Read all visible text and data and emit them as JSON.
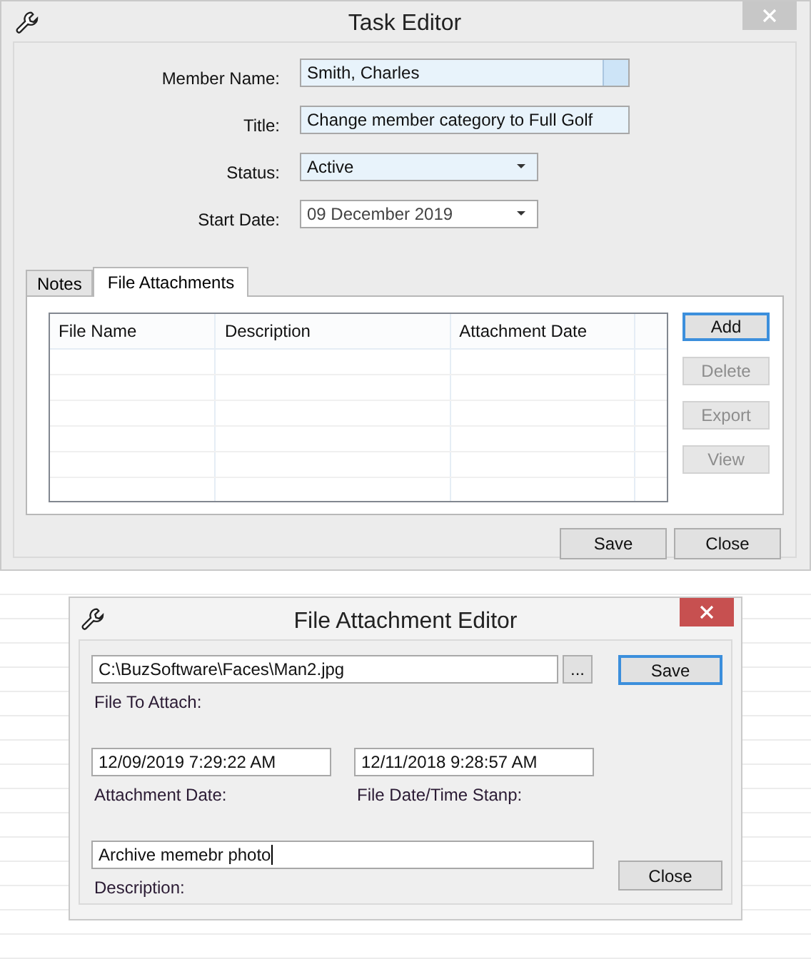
{
  "task_editor": {
    "title": "Task Editor",
    "fields": [
      {
        "kind": "lookup",
        "label": "Member Name:",
        "value": "Smith, Charles"
      },
      {
        "kind": "text",
        "label": "Title:",
        "value": "Change member category to Full Golf"
      },
      {
        "kind": "dropdown",
        "label": "Status:",
        "value": "Active"
      },
      {
        "kind": "date",
        "label": "Start Date:",
        "value": "09 December 2019"
      }
    ],
    "tabs": [
      {
        "label": "Notes",
        "selected": false
      },
      {
        "label": "File Attachments",
        "selected": true
      }
    ],
    "table": {
      "columns": [
        "File Name",
        "Description",
        "Attachment Date"
      ]
    },
    "side_buttons": [
      {
        "label": "Add",
        "disabled": false,
        "focused": true
      },
      {
        "label": "Delete",
        "disabled": true,
        "focused": false
      },
      {
        "label": "Export",
        "disabled": true,
        "focused": false
      },
      {
        "label": "View",
        "disabled": true,
        "focused": false
      }
    ],
    "buttons": [
      "Save",
      "Close"
    ]
  },
  "file_attachment_editor": {
    "title": "File Attachment Editor",
    "file_to_attach": {
      "value": "C:\\BuzSoftware\\Faces\\Man2.jpg",
      "label": "File To Attach:",
      "browse": "..."
    },
    "attachment_date": {
      "value": "12/09/2019 7:29:22 AM",
      "label": "Attachment Date:"
    },
    "file_date": {
      "value": "12/11/2018 9:28:57 AM",
      "label": "File Date/Time Stanp:"
    },
    "description": {
      "value": "Archive memebr photo",
      "label": "Description:"
    },
    "save": "Save",
    "close": "Close"
  }
}
